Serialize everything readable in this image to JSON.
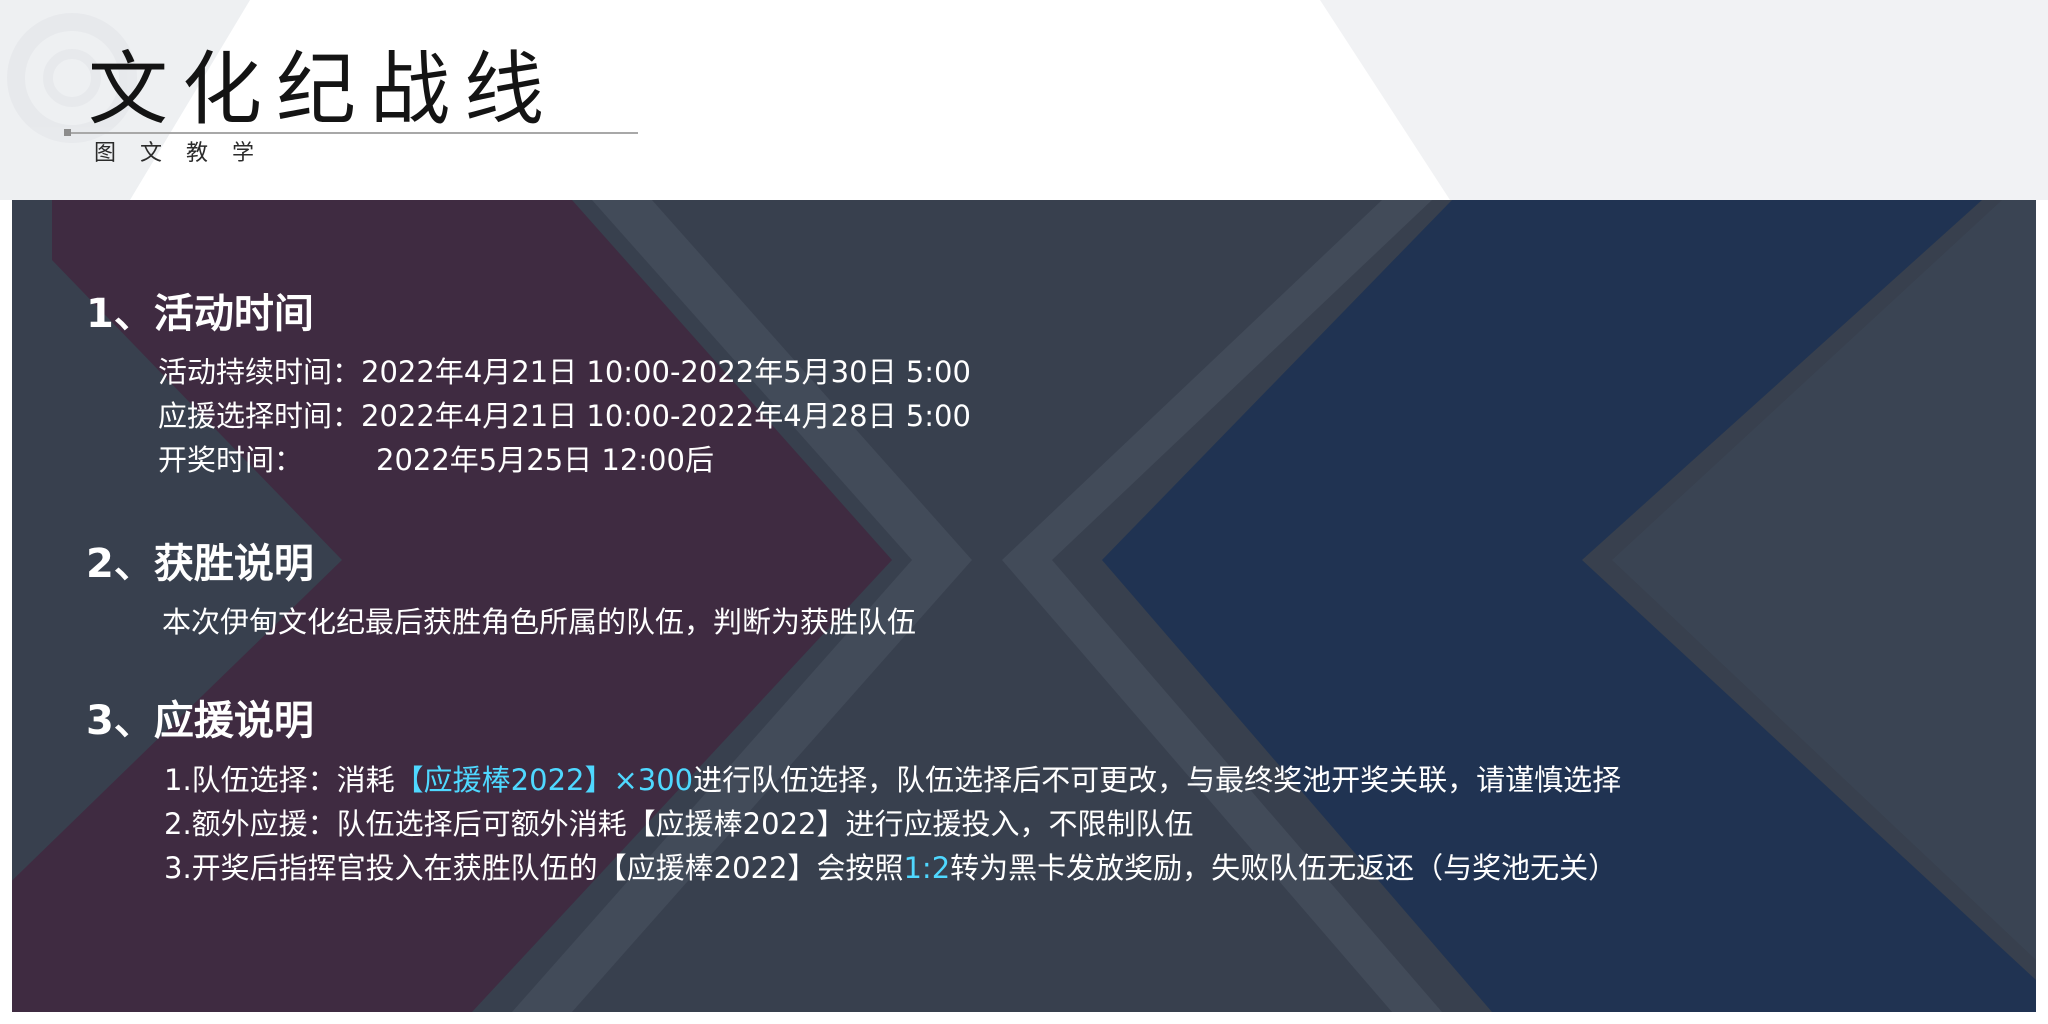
{
  "header": {
    "title": "文化纪战线",
    "subtitle": "图文教学"
  },
  "sections": [
    {
      "heading": "1、活动时间",
      "lines": [
        {
          "label": "活动持续时间：",
          "value": "2022年4月21日 10:00-2022年5月30日 5:00"
        },
        {
          "label": "应援选择时间：",
          "value": "2022年4月21日 10:00-2022年4月28日 5:00"
        },
        {
          "label": "开奖时间：",
          "value": "2022年5月25日 12:00后"
        }
      ]
    },
    {
      "heading": "2、获胜说明",
      "lines": [
        {
          "text": "本次伊甸文化纪最后获胜角色所属的队伍，判断为获胜队伍"
        }
      ]
    },
    {
      "heading": "3、应援说明",
      "lines": [
        {
          "before": "1.队伍选择：消耗",
          "highlight": "【应援棒2022】×300",
          "after": "进行队伍选择，队伍选择后不可更改，与最终奖池开奖关联，请谨慎选择"
        },
        {
          "text": "2.额外应援：队伍选择后可额外消耗【应援棒2022】进行应援投入，不限制队伍"
        },
        {
          "before": "3.开奖后指挥官投入在获胜队伍的【应援棒2022】会按照",
          "highlight": "1:2",
          "after": "转为黑卡发放奖励，失败队伍无返还（与奖池无关）"
        }
      ]
    }
  ],
  "colors": {
    "panel_background": "#38404e",
    "highlight": "#4fd8ff",
    "left_chevron": "#3f2a40",
    "right_chevron": "#1f3352",
    "text": "#ffffff"
  }
}
